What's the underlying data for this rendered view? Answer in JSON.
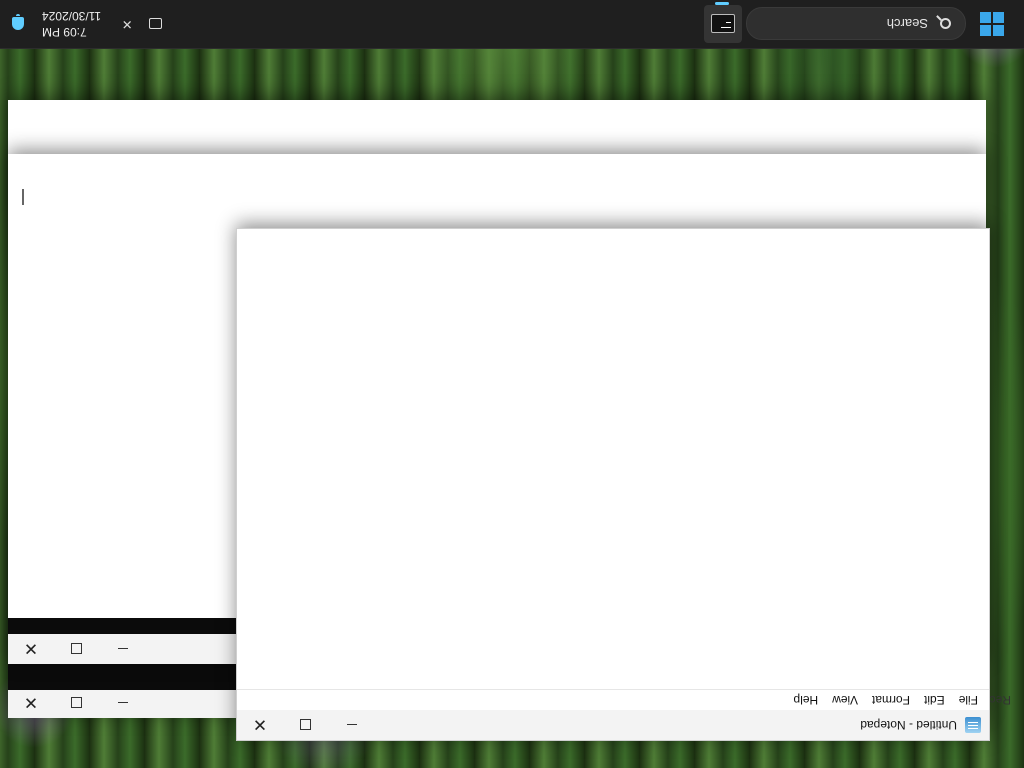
{
  "notepad": {
    "title": "Untitled - Notepad",
    "menu": [
      "File",
      "Edit",
      "Format",
      "View",
      "Help"
    ],
    "menu_cut_label": "Rec"
  },
  "taskbar": {
    "search_placeholder": "Search",
    "time": "7:09 PM",
    "date": "11/30/2024",
    "pinned_app": "terminal-icon"
  },
  "colors": {
    "taskbar": "#1f1f1f",
    "accent": "#3aa7ea",
    "window_titlebar": "#f3f3f3"
  }
}
